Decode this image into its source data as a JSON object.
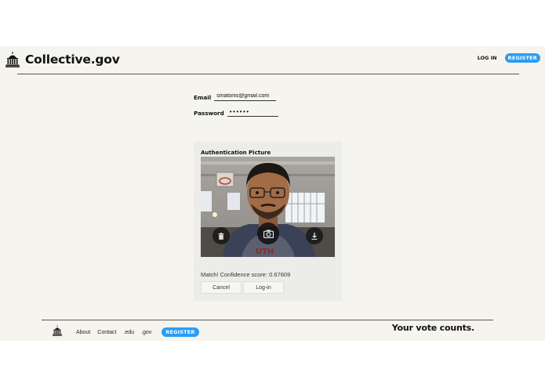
{
  "header": {
    "brand": "Collective.gov",
    "login_label": "LOG IN",
    "register_label": "REGISTER",
    "logo_icon": "capitol-building-icon"
  },
  "form": {
    "email_label": "Email",
    "email_value": "smatonis@gmail.com",
    "password_label": "Password",
    "password_value": "••••••"
  },
  "auth": {
    "title": "Authentication Picture",
    "match_text": "Match! Confidence score: 0.67609",
    "cancel_label": "Cancel",
    "login_label": "Log-in",
    "buttons": {
      "delete_icon": "trash-icon",
      "capture_icon": "camera-icon",
      "download_icon": "download-icon"
    }
  },
  "footer": {
    "links": [
      "About",
      "Contact",
      ".edu",
      ".gov"
    ],
    "register_label": "REGISTER",
    "tagline": "Your vote counts."
  },
  "colors": {
    "accent": "#2a9df4",
    "page_bg": "#f5f4ee",
    "card_bg": "#ececea"
  }
}
